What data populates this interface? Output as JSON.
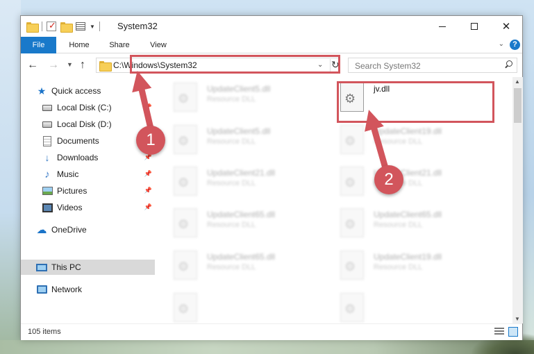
{
  "window": {
    "title": "System32"
  },
  "ribbon": {
    "tabs": [
      {
        "label": "File"
      },
      {
        "label": "Home"
      },
      {
        "label": "Share"
      },
      {
        "label": "View"
      }
    ]
  },
  "address": {
    "path": "C:\\Windows\\System32"
  },
  "search": {
    "placeholder": "Search System32"
  },
  "navpane": {
    "items": [
      {
        "label": "Quick access",
        "icon": "star-icon"
      },
      {
        "label": "Local Disk (C:)",
        "icon": "drive-icon"
      },
      {
        "label": "Local Disk (D:)",
        "icon": "drive-icon"
      },
      {
        "label": "Documents",
        "icon": "documents-icon"
      },
      {
        "label": "Downloads",
        "icon": "downloads-icon"
      },
      {
        "label": "Music",
        "icon": "music-icon"
      },
      {
        "label": "Pictures",
        "icon": "pictures-icon"
      },
      {
        "label": "Videos",
        "icon": "videos-icon"
      },
      {
        "label": "OneDrive",
        "icon": "cloud-icon"
      },
      {
        "label": "This PC",
        "icon": "computer-icon"
      },
      {
        "label": "Network",
        "icon": "network-icon"
      }
    ]
  },
  "files": {
    "focus": {
      "name": "jv.dll"
    },
    "blurred": [
      {
        "name": "UpdateClient5.dll",
        "type": "Resource DLL"
      },
      {
        "name": "UpdateClient5.dll",
        "type": "Resource DLL"
      },
      {
        "name": "UpdateClient19.dll",
        "type": "Resource DLL"
      },
      {
        "name": "UpdateClient21.dll",
        "type": "Resource DLL"
      },
      {
        "name": "UpdateClient21.dll",
        "type": "Resource DLL"
      },
      {
        "name": "UpdateClient65.dll",
        "type": "Resource DLL"
      },
      {
        "name": "UpdateClient65.dll",
        "type": "Resource DLL"
      },
      {
        "name": "UpdateClient65.dll",
        "type": "Resource DLL"
      },
      {
        "name": "UpdateClient19.dll",
        "type": "Resource DLL"
      }
    ]
  },
  "status": {
    "count": "105 items"
  },
  "annotations": {
    "step1": "1",
    "step2": "2",
    "color": "#d2555c"
  },
  "colors": {
    "accent": "#1979ca"
  }
}
